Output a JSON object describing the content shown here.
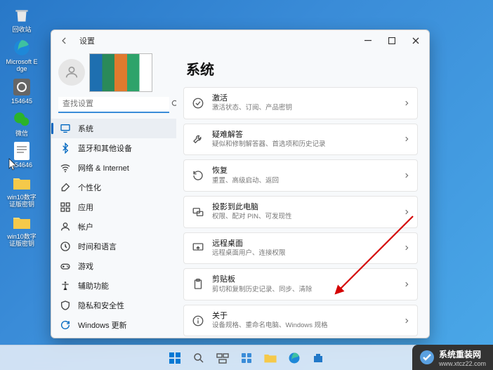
{
  "desktop": {
    "icons": [
      {
        "name": "recycle-bin",
        "label": "回收站"
      },
      {
        "name": "edge",
        "label": "Microsoft Edge"
      },
      {
        "name": "file1",
        "label": "154645"
      },
      {
        "name": "wechat",
        "label": "微信"
      },
      {
        "name": "file2",
        "label": "154646"
      },
      {
        "name": "folder1",
        "label": "win10数字证版密钥"
      },
      {
        "name": "folder2",
        "label": "win10数字证版密钥"
      }
    ]
  },
  "window": {
    "title": "设置",
    "controls": {
      "min": "minimize",
      "max": "maximize",
      "close": "close"
    }
  },
  "sidebar": {
    "search_placeholder": "查找设置",
    "items": [
      {
        "id": "system",
        "label": "系统",
        "icon": "monitor",
        "selected": true,
        "color": "#0067c0"
      },
      {
        "id": "bluetooth",
        "label": "蓝牙和其他设备",
        "icon": "bluetooth",
        "color": "#0067c0"
      },
      {
        "id": "network",
        "label": "网络 & Internet",
        "icon": "wifi",
        "color": "#444"
      },
      {
        "id": "personalize",
        "label": "个性化",
        "icon": "brush",
        "color": "#444"
      },
      {
        "id": "apps",
        "label": "应用",
        "icon": "apps",
        "color": "#444"
      },
      {
        "id": "accounts",
        "label": "帐户",
        "icon": "user",
        "color": "#444"
      },
      {
        "id": "time",
        "label": "时间和语言",
        "icon": "clock",
        "color": "#444"
      },
      {
        "id": "gaming",
        "label": "游戏",
        "icon": "gamepad",
        "color": "#444"
      },
      {
        "id": "accessibility",
        "label": "辅助功能",
        "icon": "accessibility",
        "color": "#444"
      },
      {
        "id": "privacy",
        "label": "隐私和安全性",
        "icon": "shield",
        "color": "#444"
      },
      {
        "id": "update",
        "label": "Windows 更新",
        "icon": "update",
        "color": "#0067c0"
      }
    ]
  },
  "content": {
    "title": "系统",
    "cards": [
      {
        "id": "activation",
        "title": "激活",
        "sub": "激活状态、订阅、产品密钥",
        "icon": "check"
      },
      {
        "id": "troubleshoot",
        "title": "疑难解答",
        "sub": "疑似和修制解答器、首选项和历史记录",
        "icon": "wrench"
      },
      {
        "id": "recovery",
        "title": "恢复",
        "sub": "重置、高级启动、返回",
        "icon": "recovery"
      },
      {
        "id": "project",
        "title": "投影到此电脑",
        "sub": "权限、配对 PIN、可发现性",
        "icon": "project"
      },
      {
        "id": "remote",
        "title": "远程桌面",
        "sub": "远程桌面用户、连接权限",
        "icon": "remote"
      },
      {
        "id": "clipboard",
        "title": "剪贴板",
        "sub": "剪切和复制历史记录、同步、清除",
        "icon": "clipboard"
      },
      {
        "id": "about",
        "title": "关于",
        "sub": "设备规格、重命名电脑、Windows 规格",
        "icon": "info"
      }
    ]
  },
  "watermark": {
    "brand": "系统重装网",
    "url": "www.xtcz22.com"
  },
  "colors": {
    "accent": "#0067c0"
  }
}
